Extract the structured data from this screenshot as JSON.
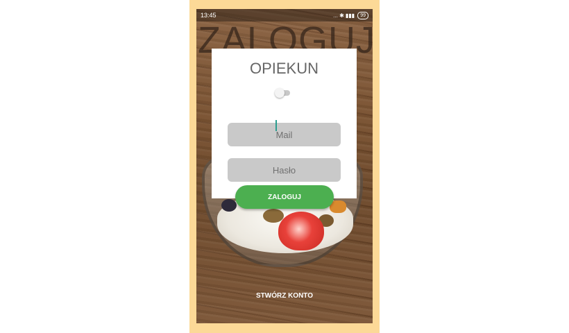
{
  "status_bar": {
    "time": "13:45",
    "indicators": "... ✱ ▮▮▮",
    "battery": "99"
  },
  "screen": {
    "headline": "ZALOGUJ",
    "card": {
      "title": "OPIEKUN",
      "toggle_on": false,
      "mail_placeholder": "Mail",
      "password_placeholder": "Hasło"
    },
    "login_button": "ZALOGUJ",
    "create_account_link": "STWÓRZ KONTO"
  },
  "colors": {
    "accent_green": "#4caf50",
    "frame_background": "#fcd997",
    "field_background": "#c9c9c9"
  }
}
